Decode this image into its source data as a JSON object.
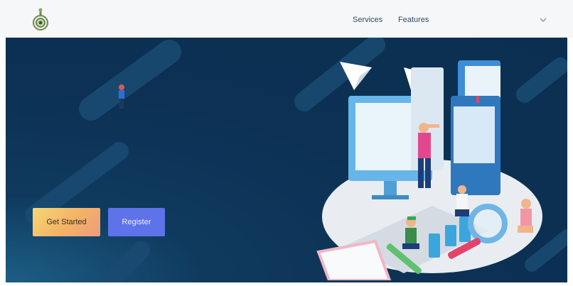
{
  "nav": {
    "links": [
      "Services",
      "Features"
    ],
    "dropdown_icon": "chevron-down-icon",
    "logo_icon": "emblem-logo-icon"
  },
  "hero": {
    "buttons": [
      "Get Started",
      "Register"
    ],
    "illustration": "education-study-illustration"
  },
  "colors": {
    "navbar_bg": "#f6f7f9",
    "hero_bg": "#0c3154",
    "register_button": "#5e73ea",
    "get_started_gradient": [
      "#f7d774",
      "#ee9c7e"
    ]
  }
}
